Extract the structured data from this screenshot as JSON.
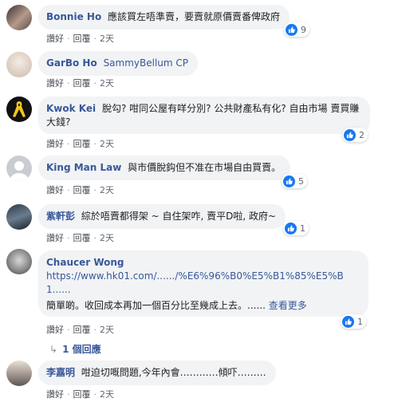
{
  "actions": {
    "like": "讚好",
    "reply": "回覆",
    "time": "2天",
    "sep": "·"
  },
  "comments": [
    {
      "name": "Bonnie Ho",
      "text": "應該買左唔準賣，要賣就原價賣番俾政府",
      "reactions": "9"
    },
    {
      "name": "GarBo Ho",
      "tag": "SammyBellum CP"
    },
    {
      "name": "Kwok Kei",
      "text": "脫勾? 咁同公屋有咩分別? 公共財產私有化? 自由市場 賣買賺大錢?",
      "reactions": "2"
    },
    {
      "name": "King Man Law",
      "text": "與市價脫鈎但不准在市場自由買賣。",
      "reactions": "5"
    },
    {
      "name": "紫軒彭",
      "text": "綜於唔賣都得架 ~ 自住架咋, 賣平D啦, 政府~",
      "reactions": "1"
    },
    {
      "name": "Chaucer Wong",
      "link": "https://www.hk01.com/....../%E6%96%B0%E5%B1%85%E5%B1......",
      "text": "簡單啲。收回成本再加一個百分比至幾成上去。......",
      "see_more": "查看更多",
      "reactions": "1",
      "replies_label": "1 個回應"
    },
    {
      "name": "李嘉明",
      "text": "咁迫切嘅問題,今年內會…………傾吓………"
    }
  ],
  "colors": {
    "link_blue": "#385898",
    "like_blue": "#1877f2",
    "bubble_bg": "#f2f3f5"
  }
}
